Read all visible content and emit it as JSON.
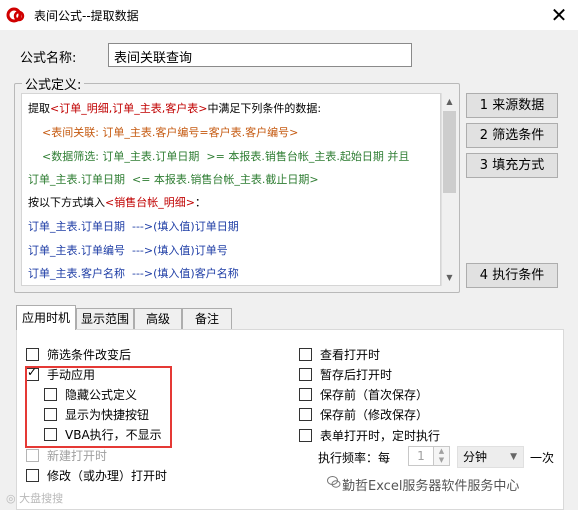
{
  "window": {
    "title": "表间公式--提取数据",
    "close_glyph": "✕"
  },
  "formula_name": {
    "label": "公式名称:",
    "value": "表间关联查询"
  },
  "definition": {
    "group_label": "公式定义:",
    "lines": [
      [
        {
          "t": "提取",
          "c": "black"
        },
        {
          "t": "<订单_明细,订单_主表,客户表>",
          "c": "red"
        },
        {
          "t": "中满足下列条件的数据:",
          "c": "black"
        }
      ],
      [
        {
          "t": "    <表间关联: 订单_主表.客户编号=客户表.客户编号>",
          "c": "orange"
        }
      ],
      [
        {
          "t": "    <数据筛选: 订单_主表.订单日期  >= 本报表.销售台帐_主表.起始日期 并且",
          "c": "green"
        }
      ],
      [
        {
          "t": "订单_主表.订单日期  <= 本报表.销售台帐_主表.截止日期>",
          "c": "green"
        }
      ],
      [
        {
          "t": "按以下方式填入",
          "c": "black"
        },
        {
          "t": "<销售台帐_明细>",
          "c": "red"
        },
        {
          "t": "：",
          "c": "black"
        }
      ],
      [
        {
          "t": "订单_主表.订单日期  --->(填入值)订单日期",
          "c": "blue"
        }
      ],
      [
        {
          "t": "订单_主表.订单编号  --->(填入值)订单号",
          "c": "blue"
        }
      ],
      [
        {
          "t": "订单_主表.客户名称  --->(填入值)客户名称",
          "c": "blue"
        }
      ]
    ]
  },
  "side_buttons": {
    "source": "1  来源数据",
    "filter": "2  筛选条件",
    "fill": "3  填充方式",
    "exec": "4  执行条件"
  },
  "tabs": [
    "应用时机",
    "显示范围",
    "高级",
    "备注"
  ],
  "left_options": {
    "filter_change": {
      "label": "筛选条件改变后",
      "checked": false
    },
    "manual": {
      "label": "手动应用",
      "checked": true
    },
    "hide_formula": {
      "label": "隐藏公式定义",
      "checked": false
    },
    "quick_button": {
      "label": "显示为快捷按钮",
      "checked": false
    },
    "vba": {
      "label": "VBA执行，不显示",
      "checked": false
    },
    "new_open": {
      "label": "新建打开时",
      "checked": false
    },
    "modify_open": {
      "label": "修改（或办理）打开时",
      "checked": false
    }
  },
  "right_options": {
    "view_open": {
      "label": "查看打开时",
      "checked": false
    },
    "after_draft": {
      "label": "暂存后打开时",
      "checked": false
    },
    "before_save_first": {
      "label": "保存前（首次保存）",
      "checked": false
    },
    "before_save_modify": {
      "label": "保存前（修改保存）",
      "checked": false
    },
    "timer": {
      "label": "表单打开时，定时执行",
      "checked": false
    }
  },
  "frequency": {
    "label": "执行频率：每",
    "value": "1",
    "unit": "分钟",
    "suffix": "一次"
  },
  "watermarks": {
    "left": "◎ 大盘搜搜",
    "right": "勤哲Excel服务器软件服务中心"
  },
  "colors": {
    "black": "#000000",
    "red": "#c00000",
    "orange": "#c55a11",
    "green": "#2e7d32",
    "blue": "#1f3ea6",
    "highlight": "#e53935"
  }
}
